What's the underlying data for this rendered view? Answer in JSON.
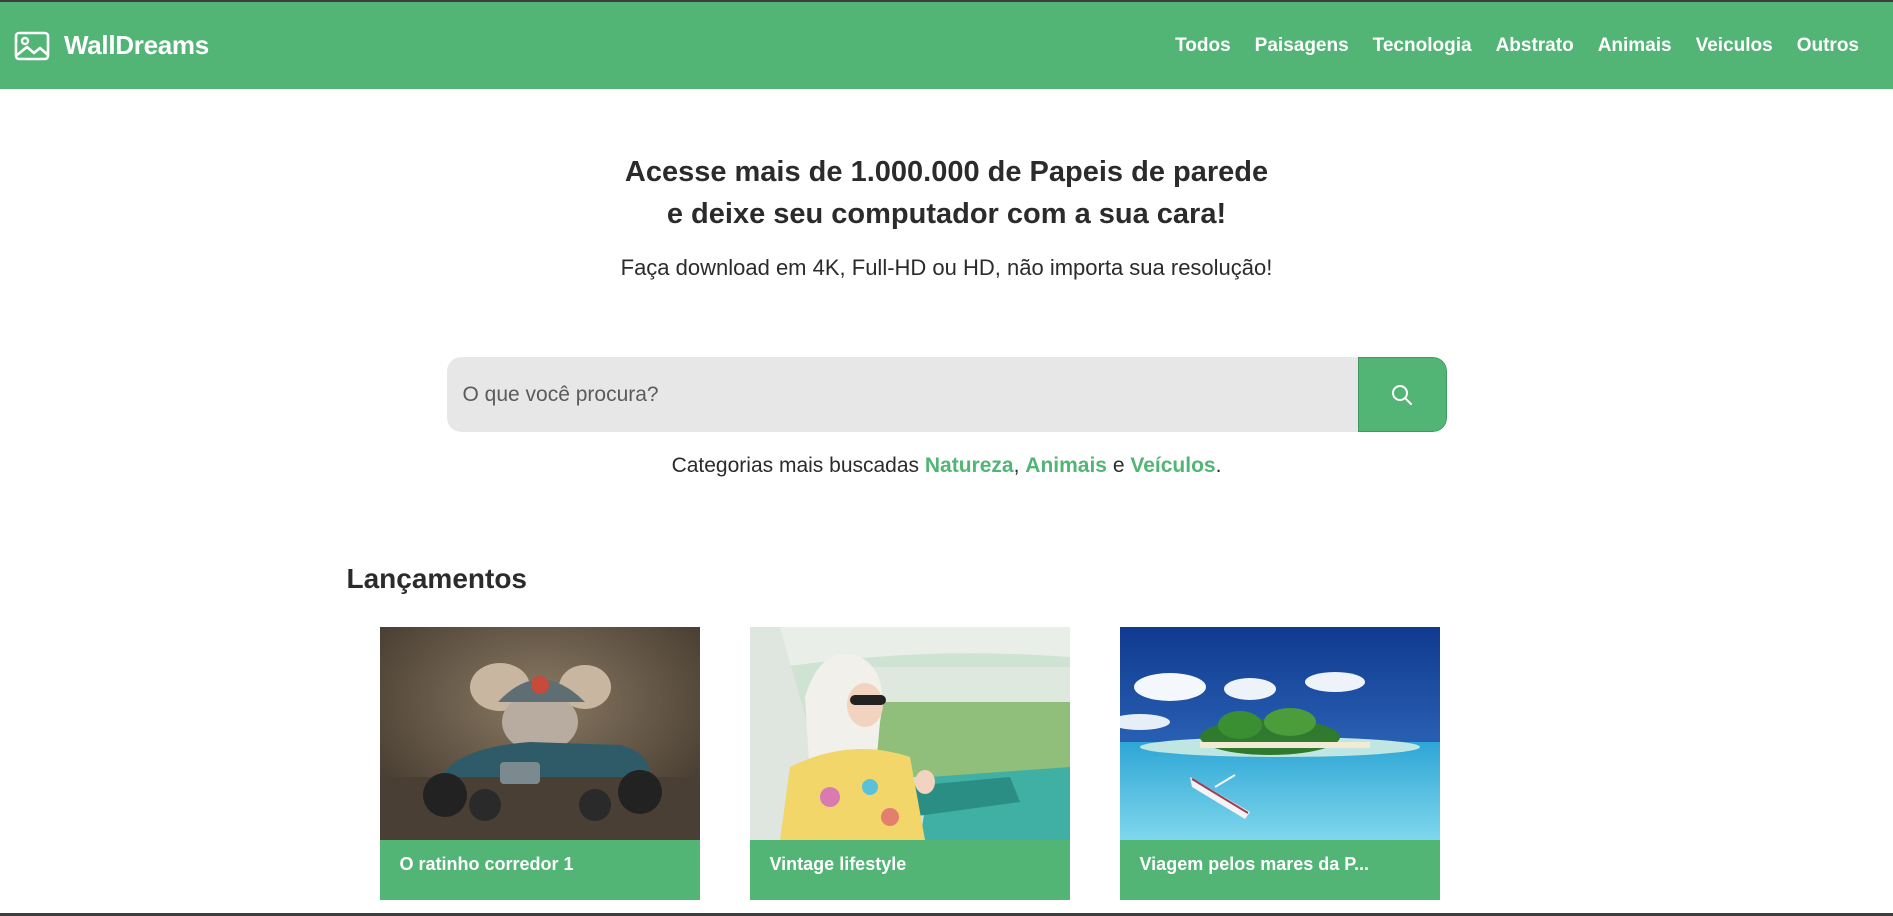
{
  "header": {
    "brand": "WallDreams",
    "nav": [
      "Todos",
      "Paisagens",
      "Tecnologia",
      "Abstrato",
      "Animais",
      "Veiculos",
      "Outros"
    ]
  },
  "hero": {
    "title_line1": "Acesse mais de 1.000.000 de Papeis de parede",
    "title_line2": "e deixe seu computador com a sua cara!",
    "subtitle": "Faça download em 4K, Full-HD ou HD, não importa sua resolução!"
  },
  "search": {
    "placeholder": "O que você procura?",
    "button_icon": "search-icon"
  },
  "popular": {
    "prefix": "Categorias mais buscadas",
    "cat1": "Natureza",
    "sep1": ",",
    "cat2": "Animais",
    "sep2": "e",
    "cat3": "Veículos",
    "end": "."
  },
  "releases": {
    "title": "Lançamentos",
    "cards": [
      {
        "caption": "O ratinho corredor 1"
      },
      {
        "caption": "Vintage lifestyle"
      },
      {
        "caption": "Viagem pelos mares da P..."
      }
    ]
  },
  "colors": {
    "brand_green": "#52b575",
    "text_dark": "#2b2b2b",
    "input_bg": "#e7e7e7"
  }
}
